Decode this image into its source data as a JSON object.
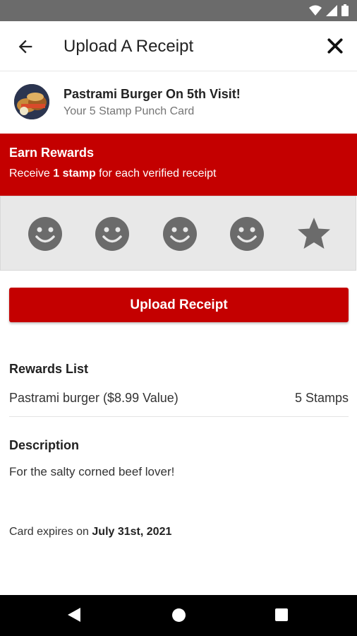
{
  "header": {
    "title": "Upload A Receipt"
  },
  "card": {
    "title": "Pastrami Burger On 5th Visit!",
    "subtitle": "Your 5 Stamp Punch Card"
  },
  "earn": {
    "title": "Earn Rewards",
    "line_pre": "Receive ",
    "line_bold": "1 stamp",
    "line_post": " for each verified receipt"
  },
  "stamps": {
    "items": [
      "smiley-icon",
      "smiley-icon",
      "smiley-icon",
      "smiley-icon",
      "star-icon"
    ],
    "colors": {
      "background": "#e8e8e8",
      "icon": "#6b6b6b"
    }
  },
  "upload_button": {
    "label": "Upload Receipt"
  },
  "rewards": {
    "title": "Rewards List",
    "items": [
      {
        "name": "Pastrami burger ($8.99 Value)",
        "value": "5 Stamps"
      }
    ]
  },
  "description": {
    "title": "Description",
    "text": "For the salty corned beef lover!"
  },
  "expiry": {
    "prefix": "Card expires on ",
    "date": "July 31st, 2021"
  },
  "colors": {
    "accent": "#c40000",
    "statusbar": "#6b6b6b"
  }
}
